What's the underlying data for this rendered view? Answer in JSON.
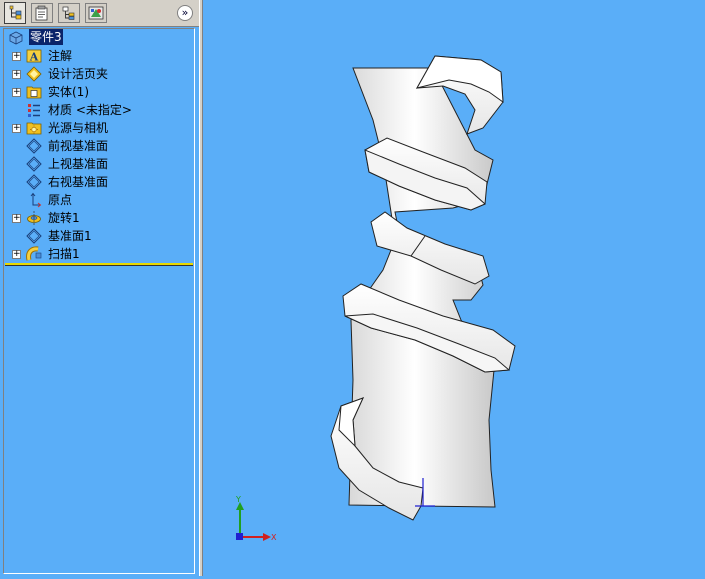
{
  "tree": {
    "root": {
      "label": "零件3",
      "icon": "part-icon"
    },
    "items": [
      {
        "label": "注解",
        "icon": "annotations-icon",
        "expandable": true
      },
      {
        "label": "设计活页夹",
        "icon": "design-binder-icon",
        "expandable": true
      },
      {
        "label": "实体(1)",
        "icon": "solid-bodies-icon",
        "expandable": true
      },
      {
        "label": "材质 <未指定>",
        "icon": "material-icon",
        "expandable": false
      },
      {
        "label": "光源与相机",
        "icon": "lights-cameras-icon",
        "expandable": true
      },
      {
        "label": "前视基准面",
        "icon": "plane-icon",
        "expandable": false
      },
      {
        "label": "上视基准面",
        "icon": "plane-icon",
        "expandable": false
      },
      {
        "label": "右视基准面",
        "icon": "plane-icon",
        "expandable": false
      },
      {
        "label": "原点",
        "icon": "origin-icon",
        "expandable": false
      },
      {
        "label": "旋转1",
        "icon": "revolve-icon",
        "expandable": true
      },
      {
        "label": "基准面1",
        "icon": "plane-icon",
        "expandable": false
      },
      {
        "label": "扫描1",
        "icon": "sweep-icon",
        "expandable": true
      }
    ]
  },
  "tabs": [
    {
      "name": "feature-manager-tab",
      "icon": "feature-tree-icon",
      "active": true
    },
    {
      "name": "property-manager-tab",
      "icon": "property-icon",
      "active": false
    },
    {
      "name": "configuration-manager-tab",
      "icon": "configuration-icon",
      "active": false
    },
    {
      "name": "display-manager-tab",
      "icon": "appearance-icon",
      "active": false
    }
  ],
  "expand_glyph": "»",
  "triad": {
    "y_label": "Y",
    "x_label": "X"
  },
  "colors": {
    "viewport_background": "#5aaef8",
    "selection": "#0a246a",
    "divider": "#e8d800",
    "triad_x": "#d02020",
    "triad_y": "#20a020",
    "triad_z": "#2020d0"
  }
}
